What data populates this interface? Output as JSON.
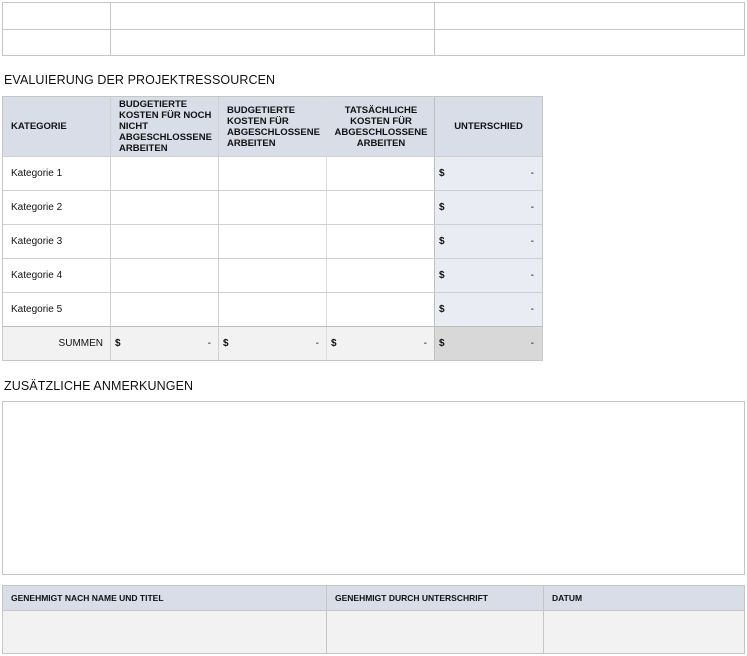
{
  "resources": {
    "title": "EVALUIERUNG DER PROJEKTRESSOURCEN",
    "headers": {
      "kategorie": "KATEGORIE",
      "budget_open": "BUDGETIERTE KOSTEN FÜR NOCH NICHT ABGESCHLOSSENE ARBEITEN",
      "budget_done": "BUDGETIERTE KOSTEN FÜR ABGESCHLOSSENE ARBEITEN",
      "actual_done": "TATSÄCHLICHE KOSTEN FÜR ABGESCHLOSSENE ARBEITEN",
      "diff": "UNTERSCHIED"
    },
    "rows": [
      {
        "label": "Kategorie 1",
        "currency": "$",
        "diff": "-"
      },
      {
        "label": "Kategorie 2",
        "currency": "$",
        "diff": "-"
      },
      {
        "label": "Kategorie 3",
        "currency": "$",
        "diff": "-"
      },
      {
        "label": "Kategorie 4",
        "currency": "$",
        "diff": "-"
      },
      {
        "label": "Kategorie 5",
        "currency": "$",
        "diff": "-"
      }
    ],
    "totals": {
      "label": "SUMMEN",
      "currency": "$",
      "budget_open": "-",
      "budget_done": "-",
      "actual_done": "-",
      "diff": "-"
    }
  },
  "notes": {
    "title": "ZUSÄTZLICHE ANMERKUNGEN",
    "value": ""
  },
  "approval": {
    "headers": {
      "name_title": "GENEHMIGT NACH NAME UND TITEL",
      "signature": "GENEHMIGT DURCH UNTERSCHRIFT",
      "date": "DATUM"
    },
    "values": {
      "name_title": "",
      "signature": "",
      "date": ""
    }
  },
  "colors": {
    "header_bg": "#d9dde8",
    "diff_bg": "#e9ecf3",
    "sum_bg": "#f2f2f2",
    "sum_diff_bg": "#d8d8d8",
    "border": "#c6c6c6"
  }
}
